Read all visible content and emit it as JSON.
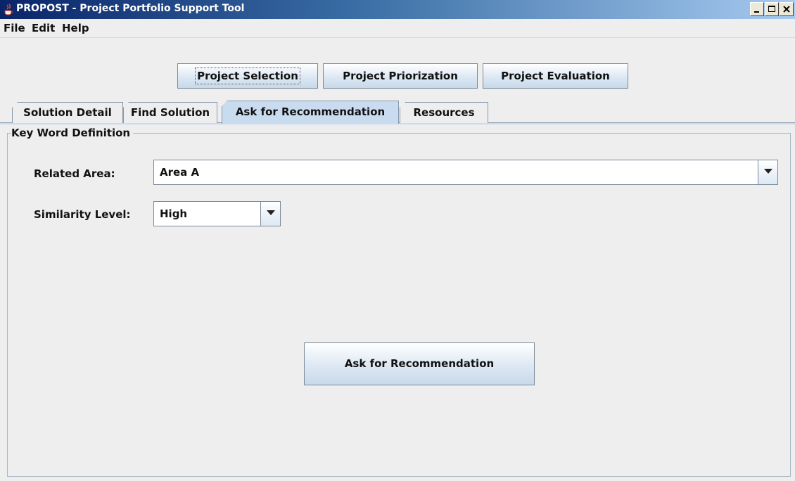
{
  "window": {
    "title": "PROPOST - Project Portfolio Support Tool",
    "icon": "java-cup-icon",
    "controls": [
      "minimize-icon",
      "maximize-icon",
      "close-icon"
    ]
  },
  "menu": {
    "items": [
      "File",
      "Edit",
      "Help"
    ]
  },
  "main_buttons": {
    "selection": "Project Selection",
    "priorization": "Project Priorization",
    "evaluation": "Project Evaluation"
  },
  "tabs": [
    {
      "label": "Solution Detail",
      "selected": false
    },
    {
      "label": "Find Solution",
      "selected": false
    },
    {
      "label": "Ask for Recommendation",
      "selected": true
    },
    {
      "label": "Resources",
      "selected": false
    }
  ],
  "panel": {
    "legend": "Key Word Definition",
    "related_area": {
      "label": "Related Area:",
      "value": "Area A"
    },
    "similarity_level": {
      "label": "Similarity Level:",
      "value": "High"
    },
    "action_button": "Ask for Recommendation"
  },
  "colors": {
    "title_gradient_start": "#0a246a",
    "title_gradient_end": "#a6caf0",
    "selected_tab": "#c9dcef",
    "background": "#eeeeee"
  }
}
